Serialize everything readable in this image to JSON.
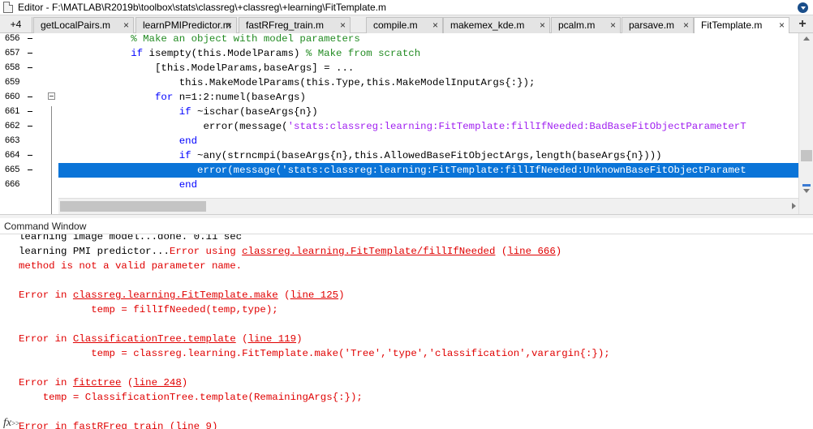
{
  "window": {
    "title": "Editor - F:\\MATLAB\\R2019b\\toolbox\\stats\\classreg\\+classreg\\+learning\\FitTemplate.m"
  },
  "tabs": {
    "more_label": "+4",
    "add_label": "+",
    "close_glyph": "×",
    "items": [
      {
        "label": "getLocalPairs.m"
      },
      {
        "label": "learnPMIPredictor.m"
      },
      {
        "label": "fastRFreg_train.m"
      },
      {
        "label": "compile.m"
      },
      {
        "label": "makemex_kde.m"
      },
      {
        "label": "pcalm.m"
      },
      {
        "label": "parsave.m"
      },
      {
        "label": "FitTemplate.m",
        "active": true
      }
    ]
  },
  "editor": {
    "lines": [
      {
        "num": "656",
        "dash": true,
        "indent": "            ",
        "parts": [
          {
            "t": "% Make an object with model parameters",
            "c": "cm"
          }
        ]
      },
      {
        "num": "657",
        "dash": true,
        "indent": "            ",
        "parts": [
          {
            "t": "if",
            "c": "kw"
          },
          {
            "t": " isempty(this.ModelParams) "
          },
          {
            "t": "% Make from scratch",
            "c": "cm"
          }
        ]
      },
      {
        "num": "658",
        "dash": true,
        "indent": "                ",
        "parts": [
          {
            "t": "[this.ModelParams,baseArgs] = ..."
          }
        ]
      },
      {
        "num": "659",
        "dash": false,
        "indent": "                    ",
        "parts": [
          {
            "t": "this.MakeModelParams(this.Type,this.MakeModelInputArgs{:});"
          }
        ]
      },
      {
        "num": "660",
        "dash": true,
        "indent": "                ",
        "parts": [
          {
            "t": "for",
            "c": "kw"
          },
          {
            "t": " n=1:2:numel(baseArgs)"
          }
        ],
        "fold": true
      },
      {
        "num": "661",
        "dash": true,
        "indent": "                    ",
        "parts": [
          {
            "t": "if",
            "c": "kw"
          },
          {
            "t": " ~ischar(baseArgs{n})"
          }
        ]
      },
      {
        "num": "662",
        "dash": true,
        "indent": "                        ",
        "parts": [
          {
            "t": "error(message("
          },
          {
            "t": "'stats:classreg:learning:FitTemplate:fillIfNeeded:BadBaseFitObjectParameterT",
            "c": "st"
          }
        ]
      },
      {
        "num": "663",
        "dash": false,
        "indent": "                    ",
        "parts": [
          {
            "t": "end",
            "c": "kw"
          }
        ]
      },
      {
        "num": "664",
        "dash": true,
        "indent": "                    ",
        "parts": [
          {
            "t": "if",
            "c": "kw"
          },
          {
            "t": " ~any(strncmpi(baseArgs{n},this.AllowedBaseFitObjectArgs,length(baseArgs{n})))"
          }
        ]
      },
      {
        "num": "665",
        "dash": true,
        "indent": "                       ",
        "parts": [
          {
            "t": "error(message("
          },
          {
            "t": "'stats:classreg:learning:FitTemplate:fillIfNeeded:UnknownBaseFitObjectParamet",
            "c": "st"
          }
        ],
        "selected": true
      },
      {
        "num": "666",
        "dash": false,
        "indent": "                    ",
        "parts": [
          {
            "t": "end",
            "c": "kw"
          }
        ]
      }
    ]
  },
  "command_window": {
    "label": "Command Window",
    "fx_label": "fx",
    "fx_sub": ">>",
    "lines": [
      {
        "text": "learning image model...done. 0.11 sec",
        "cls": "clip"
      },
      {
        "parts": [
          {
            "t": "learning PMI predictor..."
          },
          {
            "t": "Error using ",
            "err": true
          },
          {
            "t": "classreg.learning.FitTemplate/fillIfNeeded",
            "link": true
          },
          {
            "t": " (",
            "err": true
          },
          {
            "t": "line 666",
            "link": true
          },
          {
            "t": ")",
            "err": true
          }
        ]
      },
      {
        "parts": [
          {
            "t": "method is not a valid parameter name.",
            "err": true
          }
        ]
      },
      {
        "parts": []
      },
      {
        "parts": [
          {
            "t": "Error in ",
            "err": true
          },
          {
            "t": "classreg.learning.FitTemplate.make",
            "link": true
          },
          {
            "t": " (",
            "err": true
          },
          {
            "t": "line 125",
            "link": true
          },
          {
            "t": ")",
            "err": true
          }
        ]
      },
      {
        "parts": [
          {
            "t": "            temp = fillIfNeeded(temp,type);",
            "err": true
          }
        ]
      },
      {
        "parts": []
      },
      {
        "parts": [
          {
            "t": "Error in ",
            "err": true
          },
          {
            "t": "ClassificationTree.template",
            "link": true
          },
          {
            "t": " (",
            "err": true
          },
          {
            "t": "line 119",
            "link": true
          },
          {
            "t": ")",
            "err": true
          }
        ]
      },
      {
        "parts": [
          {
            "t": "            temp = classreg.learning.FitTemplate.make('Tree','type','classification',varargin{:});",
            "err": true
          }
        ]
      },
      {
        "parts": []
      },
      {
        "parts": [
          {
            "t": "Error in ",
            "err": true
          },
          {
            "t": "fitctree",
            "link": true
          },
          {
            "t": " (",
            "err": true
          },
          {
            "t": "line 248",
            "link": true
          },
          {
            "t": ")",
            "err": true
          }
        ]
      },
      {
        "parts": [
          {
            "t": "    temp = ClassificationTree.template(RemainingArgs{:});",
            "err": true
          }
        ]
      },
      {
        "parts": []
      },
      {
        "parts": [
          {
            "t": "Error in ",
            "err": true
          },
          {
            "t": "fastRFreg_train",
            "link": true
          },
          {
            "t": " (",
            "err": true
          },
          {
            "t": "line 9",
            "link": true
          },
          {
            "t": ")",
            "err": true
          }
        ]
      }
    ]
  },
  "colors": {
    "selection": "#0a74d8",
    "keyword": "#0000ff",
    "comment": "#228b22",
    "string": "#a020f0",
    "error": "#e00000"
  }
}
